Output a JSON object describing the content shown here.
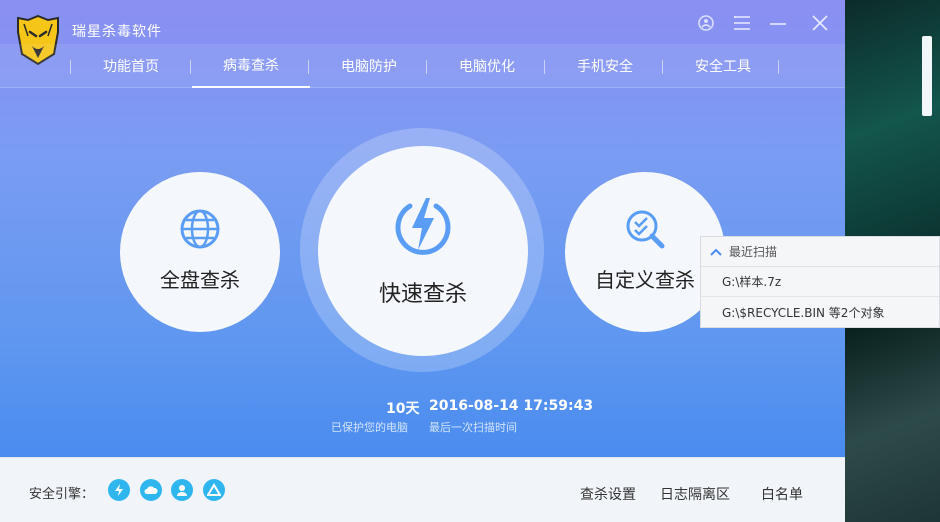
{
  "app": {
    "title": "瑞星杀毒软件"
  },
  "nav": {
    "tabs": [
      {
        "label": "功能首页"
      },
      {
        "label": "病毒查杀"
      },
      {
        "label": "电脑防护"
      },
      {
        "label": "电脑优化"
      },
      {
        "label": "手机安全"
      },
      {
        "label": "安全工具"
      }
    ],
    "active_index": 1
  },
  "scan": {
    "full": "全盘查杀",
    "quick": "快速查杀",
    "custom": "自定义查杀"
  },
  "stats": {
    "days_value": "10天",
    "days_label": "已保护您的电脑",
    "last_scan_value": "2016-08-14 17:59:43",
    "last_scan_label": "最后一次扫描时间"
  },
  "recent": {
    "title": "最近扫描",
    "items": [
      "G:\\样本.7z",
      "G:\\$RECYCLE.BIN 等2个对象"
    ]
  },
  "bottom": {
    "engine_label": "安全引擎：",
    "links": [
      "查杀设置",
      "日志隔离区",
      "白名单"
    ]
  },
  "colors": {
    "accent": "#4a8cef",
    "icon_blue": "#5a9df5",
    "engine_blue": "#2fb6ef"
  }
}
